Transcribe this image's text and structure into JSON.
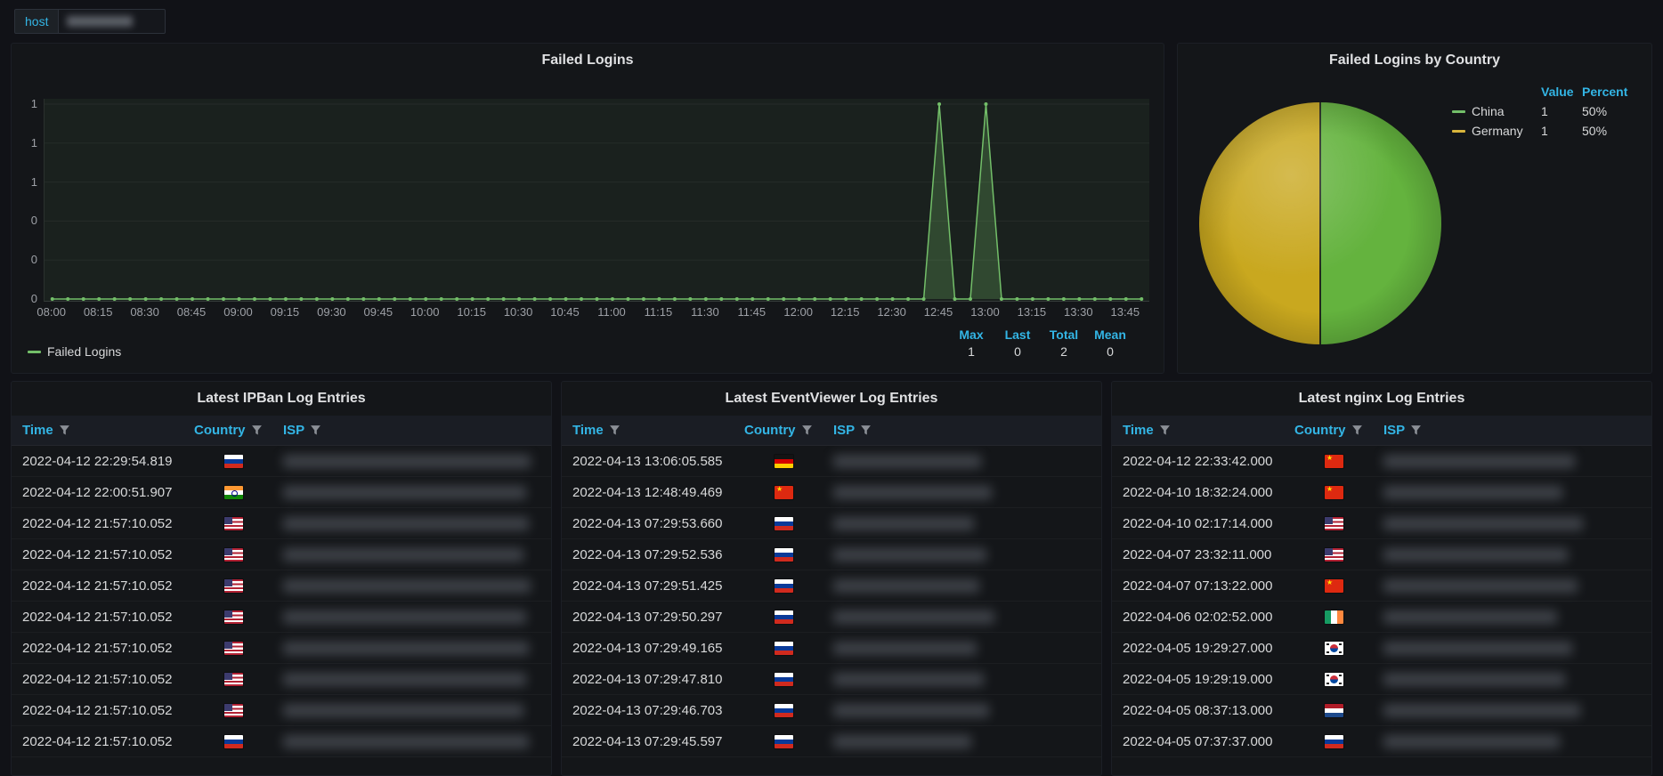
{
  "colors": {
    "page_bg": "#111217",
    "panel_bg": "#141619",
    "accent_blue": "#33B5E5",
    "series_green": "#73BF69",
    "pie_green": "#64B33E",
    "pie_yellow": "#C9A81F"
  },
  "toolbar": {
    "variable_label": "host"
  },
  "failed_logins_panel": {
    "title": "Failed Logins",
    "legend": {
      "series_label": "Failed Logins",
      "stat_headers": [
        "Max",
        "Last",
        "Total",
        "Mean"
      ],
      "stat_values": [
        "1",
        "0",
        "2",
        "0"
      ]
    }
  },
  "pie_panel": {
    "title": "Failed Logins by Country",
    "legend": {
      "value_header": "Value",
      "percent_header": "Percent",
      "rows": [
        {
          "name": "China",
          "value": "1",
          "percent": "50%",
          "color": "#73BF69"
        },
        {
          "name": "Germany",
          "value": "1",
          "percent": "50%",
          "color": "#D9B53C"
        }
      ]
    }
  },
  "tables": [
    {
      "title": "Latest IPBan Log Entries",
      "columns": [
        "Time",
        "Country",
        "ISP"
      ],
      "rows": [
        {
          "time": "2022-04-12 22:29:54.819",
          "cc": "ru",
          "country": "Russia"
        },
        {
          "time": "2022-04-12 22:00:51.907",
          "cc": "in",
          "country": "India"
        },
        {
          "time": "2022-04-12 21:57:10.052",
          "cc": "us",
          "country": "United States"
        },
        {
          "time": "2022-04-12 21:57:10.052",
          "cc": "us",
          "country": "United States"
        },
        {
          "time": "2022-04-12 21:57:10.052",
          "cc": "us",
          "country": "United States"
        },
        {
          "time": "2022-04-12 21:57:10.052",
          "cc": "us",
          "country": "United States"
        },
        {
          "time": "2022-04-12 21:57:10.052",
          "cc": "us",
          "country": "United States"
        },
        {
          "time": "2022-04-12 21:57:10.052",
          "cc": "us",
          "country": "United States"
        },
        {
          "time": "2022-04-12 21:57:10.052",
          "cc": "us",
          "country": "United States"
        },
        {
          "time": "2022-04-12 21:57:10.052",
          "cc": "ru",
          "country": "Russia"
        }
      ]
    },
    {
      "title": "Latest EventViewer Log Entries",
      "columns": [
        "Time",
        "Country",
        "ISP"
      ],
      "rows": [
        {
          "time": "2022-04-13 13:06:05.585",
          "cc": "de",
          "country": "Germany"
        },
        {
          "time": "2022-04-13 12:48:49.469",
          "cc": "cn",
          "country": "China"
        },
        {
          "time": "2022-04-13 07:29:53.660",
          "cc": "ru",
          "country": "Russia"
        },
        {
          "time": "2022-04-13 07:29:52.536",
          "cc": "ru",
          "country": "Russia"
        },
        {
          "time": "2022-04-13 07:29:51.425",
          "cc": "ru",
          "country": "Russia"
        },
        {
          "time": "2022-04-13 07:29:50.297",
          "cc": "ru",
          "country": "Russia"
        },
        {
          "time": "2022-04-13 07:29:49.165",
          "cc": "ru",
          "country": "Russia"
        },
        {
          "time": "2022-04-13 07:29:47.810",
          "cc": "ru",
          "country": "Russia"
        },
        {
          "time": "2022-04-13 07:29:46.703",
          "cc": "ru",
          "country": "Russia"
        },
        {
          "time": "2022-04-13 07:29:45.597",
          "cc": "ru",
          "country": "Russia"
        }
      ]
    },
    {
      "title": "Latest nginx Log Entries",
      "columns": [
        "Time",
        "Country",
        "ISP"
      ],
      "rows": [
        {
          "time": "2022-04-12 22:33:42.000",
          "cc": "cn",
          "country": "China"
        },
        {
          "time": "2022-04-10 18:32:24.000",
          "cc": "cn",
          "country": "China"
        },
        {
          "time": "2022-04-10 02:17:14.000",
          "cc": "us",
          "country": "United States"
        },
        {
          "time": "2022-04-07 23:32:11.000",
          "cc": "us",
          "country": "United States"
        },
        {
          "time": "2022-04-07 07:13:22.000",
          "cc": "cn",
          "country": "China"
        },
        {
          "time": "2022-04-06 02:02:52.000",
          "cc": "ie",
          "country": "Ireland"
        },
        {
          "time": "2022-04-05 19:29:27.000",
          "cc": "kr",
          "country": "South Korea"
        },
        {
          "time": "2022-04-05 19:29:19.000",
          "cc": "kr",
          "country": "South Korea"
        },
        {
          "time": "2022-04-05 08:37:13.000",
          "cc": "nl",
          "country": "Netherlands"
        },
        {
          "time": "2022-04-05 07:37:37.000",
          "cc": "ru",
          "country": "Russia"
        }
      ]
    }
  ],
  "chart_data": [
    {
      "type": "area",
      "title": "Failed Logins",
      "x_start": "08:00",
      "x_end": "13:50",
      "x_step_minutes": 5,
      "x_tick_labels": [
        "08:00",
        "08:15",
        "08:30",
        "08:45",
        "09:00",
        "09:15",
        "09:30",
        "09:45",
        "10:00",
        "10:15",
        "10:30",
        "10:45",
        "11:00",
        "11:15",
        "11:30",
        "11:45",
        "12:00",
        "12:15",
        "12:30",
        "12:45",
        "13:00",
        "13:15",
        "13:30",
        "13:45"
      ],
      "values": [
        0,
        0,
        0,
        0,
        0,
        0,
        0,
        0,
        0,
        0,
        0,
        0,
        0,
        0,
        0,
        0,
        0,
        0,
        0,
        0,
        0,
        0,
        0,
        0,
        0,
        0,
        0,
        0,
        0,
        0,
        0,
        0,
        0,
        0,
        0,
        0,
        0,
        0,
        0,
        0,
        0,
        0,
        0,
        0,
        0,
        0,
        0,
        0,
        0,
        0,
        0,
        0,
        0,
        0,
        0,
        0,
        0,
        1,
        0,
        0,
        1,
        0,
        0,
        0,
        0,
        0,
        0,
        0,
        0,
        0,
        0
      ],
      "ylim": [
        0,
        1
      ],
      "y_tick_labels_top_to_bottom": [
        "1",
        "1",
        "1",
        "0",
        "0",
        "0"
      ],
      "grid": true,
      "legend_position": "bottom",
      "series": [
        {
          "name": "Failed Logins",
          "color": "#73BF69"
        }
      ],
      "stats": {
        "max": 1,
        "last": 0,
        "total": 2,
        "mean": 0
      }
    },
    {
      "type": "pie",
      "title": "Failed Logins by Country",
      "labels": [
        "China",
        "Germany"
      ],
      "values": [
        1,
        1
      ],
      "percents": [
        "50%",
        "50%"
      ],
      "colors": [
        "#64B33E",
        "#C9A81F"
      ],
      "legend_position": "right-top"
    }
  ]
}
